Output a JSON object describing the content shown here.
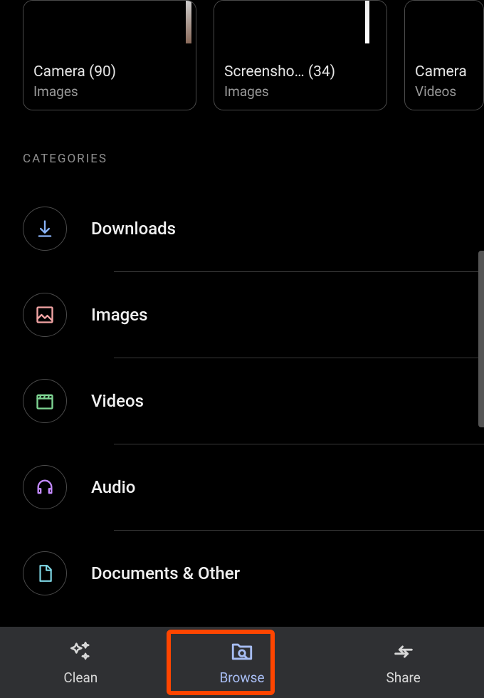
{
  "folders": [
    {
      "title": "Camera",
      "count": "(90)",
      "sub": "Images"
    },
    {
      "title": "Screensho…",
      "count": "(34)",
      "sub": "Images"
    },
    {
      "title": "Camera",
      "count": "",
      "sub": "Videos"
    }
  ],
  "section_label": "CATEGORIES",
  "categories": [
    {
      "label": "Downloads",
      "icon": "download"
    },
    {
      "label": "Images",
      "icon": "image"
    },
    {
      "label": "Videos",
      "icon": "video"
    },
    {
      "label": "Audio",
      "icon": "audio"
    },
    {
      "label": "Documents & Other",
      "icon": "document"
    }
  ],
  "nav": {
    "clean": "Clean",
    "browse": "Browse",
    "share": "Share"
  },
  "colors": {
    "download": "#8ab4f8",
    "image": "#f2a4a4",
    "video": "#7ed492",
    "audio": "#c48aff",
    "document": "#7fd7e5",
    "active": "#a7bdf3",
    "highlight": "#ff4500"
  }
}
